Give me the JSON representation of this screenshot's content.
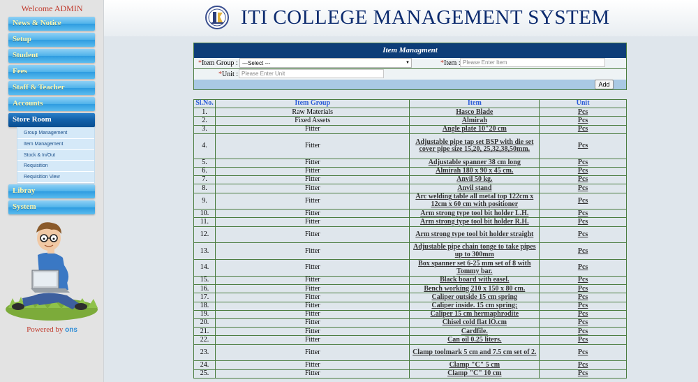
{
  "sidebar": {
    "welcome": "Welcome ADMIN",
    "menu": [
      {
        "label": "News & Notice"
      },
      {
        "label": "Setup"
      },
      {
        "label": "Student"
      },
      {
        "label": "Fees"
      },
      {
        "label": "Staff & Teacher"
      },
      {
        "label": "Accounts"
      },
      {
        "label": "Store Room"
      },
      {
        "label": "Libray"
      },
      {
        "label": "System"
      }
    ],
    "submenu": [
      {
        "label": "Group Management"
      },
      {
        "label": "Item Management"
      },
      {
        "label": "Stock & In/Out"
      },
      {
        "label": "Requisition"
      },
      {
        "label": "Requisition View"
      }
    ],
    "powered_by": "Powered by",
    "powered_brand": "ons"
  },
  "header": {
    "title": "ITI COLLEGE MANAGEMENT SYSTEM"
  },
  "form": {
    "title": "Item Managment",
    "group_label": "Item Group :",
    "group_selected": "---Select ---",
    "item_label": "Item :",
    "item_placeholder": "Please Enter Item",
    "unit_label": "Unit :",
    "unit_placeholder": "Please Enter Unit",
    "required_mark": "*",
    "add_button": "Add"
  },
  "table": {
    "columns": [
      "Sl.No.",
      "Item Group",
      "Item",
      "Unit"
    ],
    "rows": [
      {
        "no": "1.",
        "group": "Raw Materials",
        "item": "Hasco Blade",
        "unit": "Pcs"
      },
      {
        "no": "2.",
        "group": "Fixed Assets",
        "item": "Almirah",
        "unit": "Pcs"
      },
      {
        "no": "3.",
        "group": "Fitter",
        "item": "Angle plate 10\"20 cm",
        "unit": "Pcs"
      },
      {
        "no": "4.",
        "group": "Fitter",
        "item": "Adjustable pipe tap set BSP with die set cover pipe size 15,20, 25,32,38,50mm.",
        "unit": "Pcs"
      },
      {
        "no": "5.",
        "group": "Fitter",
        "item": "Adjustable spanner 38 cm long",
        "unit": "Pcs"
      },
      {
        "no": "6.",
        "group": "Fitter",
        "item": "Almirah 180 x 90 x 45 cm.",
        "unit": "Pcs"
      },
      {
        "no": "7.",
        "group": "Fitter",
        "item": "Anvil 50 kg.",
        "unit": "Pcs"
      },
      {
        "no": "8.",
        "group": "Fitter",
        "item": "Anvil stand",
        "unit": "Pcs"
      },
      {
        "no": "9.",
        "group": "Fitter",
        "item": "Arc welding table all metal top 122cm x 12cm x 60 cm with positioner",
        "unit": "Pcs"
      },
      {
        "no": "10.",
        "group": "Fitter",
        "item": "Arm strong type tool bit holder L.H.",
        "unit": "Pcs"
      },
      {
        "no": "11.",
        "group": "Fitter",
        "item": "Arm strong type tool bit holder R.H.",
        "unit": "Pcs"
      },
      {
        "no": "12.",
        "group": "Fitter",
        "item": "Arm strong type tool bit holder straight",
        "unit": "Pcs"
      },
      {
        "no": "13.",
        "group": "Fitter",
        "item": "Adjustable pipe chain tonge to take pipes up to 300mm",
        "unit": "Pcs"
      },
      {
        "no": "14.",
        "group": "Fitter",
        "item": "Box spanner set 6-25 mm set of 8 with Tommy bar.",
        "unit": "Pcs"
      },
      {
        "no": "15.",
        "group": "Fitter",
        "item": "Black board with easel.",
        "unit": "Pcs"
      },
      {
        "no": "16.",
        "group": "Fitter",
        "item": "Bench working 210 x 150 x 80 cm.",
        "unit": "Pcs"
      },
      {
        "no": "17.",
        "group": "Fitter",
        "item": "Caliper outside 15 cm spring",
        "unit": "Pcs"
      },
      {
        "no": "18.",
        "group": "Fitter",
        "item": "Caliper inside. 15 cm spring;",
        "unit": "Pcs"
      },
      {
        "no": "19.",
        "group": "Fitter",
        "item": "Caliper 15 cm hermaphrodite",
        "unit": "Pcs"
      },
      {
        "no": "20.",
        "group": "Fitter",
        "item": "Chisel cold flat lO.cm",
        "unit": "Pcs"
      },
      {
        "no": "21.",
        "group": "Fitter",
        "item": "Cardfile.",
        "unit": "Pcs"
      },
      {
        "no": "22.",
        "group": "Fitter",
        "item": "Can oil 0.25 liters.",
        "unit": "Pcs"
      },
      {
        "no": "23.",
        "group": "Fitter",
        "item": "Clamp toolmark 5 cm and 7.5 cm set of 2.",
        "unit": "Pcs"
      },
      {
        "no": "24.",
        "group": "Fitter",
        "item": "Clamp \"C\" 5 cm",
        "unit": "Pcs"
      },
      {
        "no": "25.",
        "group": "Fitter",
        "item": "Clamp \"C\" 10 cm",
        "unit": "Pcs"
      }
    ]
  }
}
